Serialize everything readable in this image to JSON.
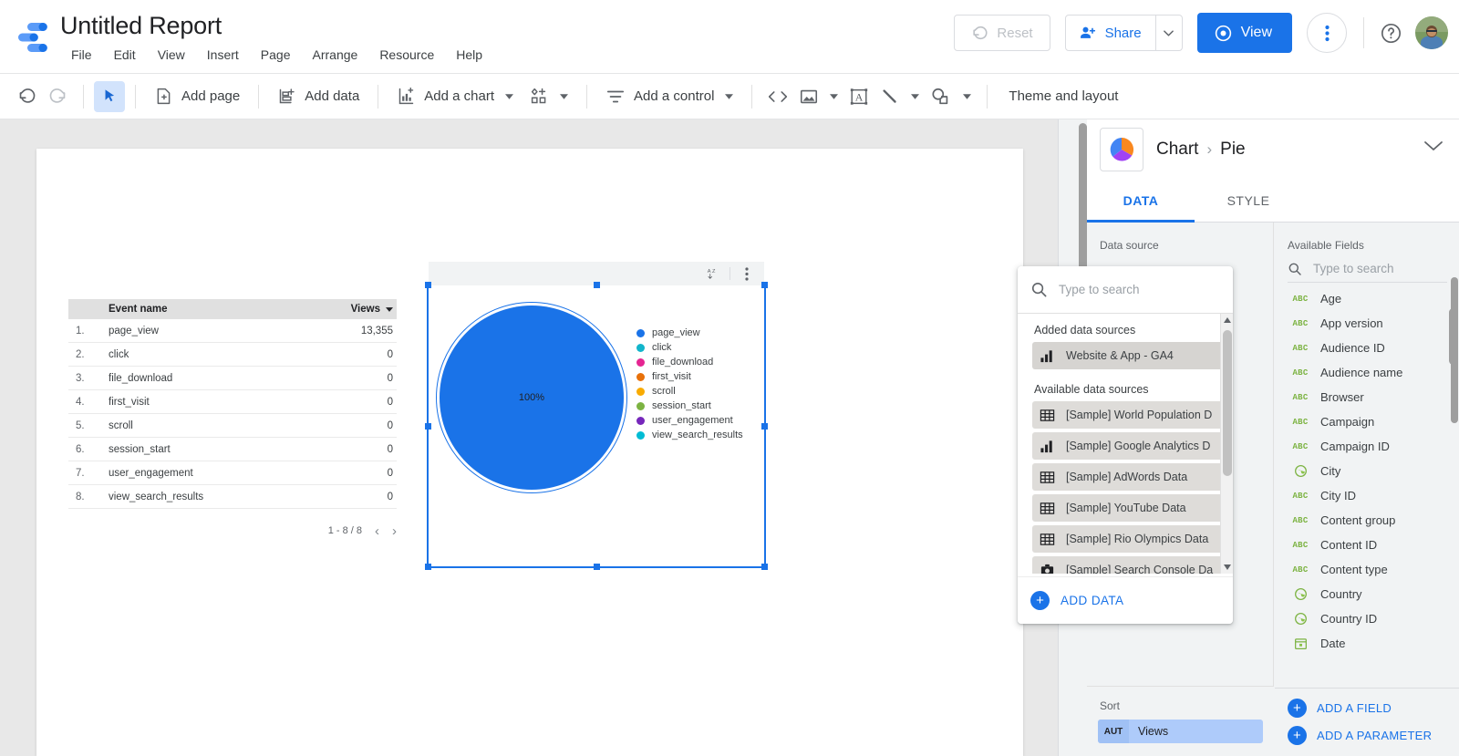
{
  "header": {
    "logo_name": "looker-studio-logo",
    "title": "Untitled Report",
    "menu": [
      "File",
      "Edit",
      "View",
      "Insert",
      "Page",
      "Arrange",
      "Resource",
      "Help"
    ],
    "reset_label": "Reset",
    "share_label": "Share",
    "view_label": "View",
    "more_label": "More options",
    "help_label": "Help",
    "avatar_label": "Account"
  },
  "toolbar": {
    "undo": "Undo",
    "redo": "Redo",
    "select": "Select tool",
    "add_page": "Add page",
    "add_data": "Add data",
    "add_chart": "Add a chart",
    "add_component": "Add a component",
    "add_control": "Add a control",
    "embed": "Embed code",
    "image": "Image",
    "text": "Text box",
    "line": "Line",
    "shape": "Shape",
    "theme": "Theme and layout"
  },
  "canvas": {
    "table": {
      "columns": [
        "",
        "Event name",
        "Views"
      ],
      "rows": [
        {
          "idx": "1.",
          "name": "page_view",
          "views": "13,355"
        },
        {
          "idx": "2.",
          "name": "click",
          "views": "0"
        },
        {
          "idx": "3.",
          "name": "file_download",
          "views": "0"
        },
        {
          "idx": "4.",
          "name": "first_visit",
          "views": "0"
        },
        {
          "idx": "5.",
          "name": "scroll",
          "views": "0"
        },
        {
          "idx": "6.",
          "name": "session_start",
          "views": "0"
        },
        {
          "idx": "7.",
          "name": "user_engagement",
          "views": "0"
        },
        {
          "idx": "8.",
          "name": "view_search_results",
          "views": "0"
        }
      ],
      "pagination": "1 - 8 / 8",
      "prev": "‹",
      "next": "›"
    },
    "chart_widget": {
      "sort_icon": "sort-az-icon",
      "more_icon": "more-vert-icon",
      "center_label": "100%"
    }
  },
  "chart_data": {
    "type": "pie",
    "title": "",
    "categories": [
      "page_view",
      "click",
      "file_download",
      "first_visit",
      "scroll",
      "session_start",
      "user_engagement",
      "view_search_results"
    ],
    "values": [
      13355,
      0,
      0,
      0,
      0,
      0,
      0,
      0
    ],
    "percentages": [
      100,
      0,
      0,
      0,
      0,
      0,
      0,
      0
    ],
    "colors": [
      "#1a73e8",
      "#12b5cb",
      "#e52592",
      "#e8710a",
      "#f9ab00",
      "#7cb342",
      "#7627bb",
      "#00bcd4"
    ],
    "data_labels": [
      "100%"
    ],
    "legend_position": "right",
    "metric": "Views",
    "dimension": "Event name"
  },
  "right_panel": {
    "breadcrumb_root": "Chart",
    "breadcrumb_sep": "›",
    "breadcrumb_leaf": "Pie",
    "collapse_icon": "chevron-down-icon",
    "thumb_icon": "pie-chart-icon",
    "tabs": [
      {
        "label": "DATA",
        "active": true
      },
      {
        "label": "STYLE",
        "active": false
      }
    ],
    "data_source_label": "Data source",
    "sort_label": "Sort",
    "sort_chip": {
      "badge": "AUT",
      "name": "Views"
    },
    "available_fields": {
      "title": "Available Fields",
      "search_placeholder": "Type to search",
      "search_value": "",
      "fields": [
        {
          "type": "ABC",
          "name": "Age"
        },
        {
          "type": "ABC",
          "name": "App version"
        },
        {
          "type": "ABC",
          "name": "Audience ID"
        },
        {
          "type": "ABC",
          "name": "Audience name"
        },
        {
          "type": "ABC",
          "name": "Browser"
        },
        {
          "type": "ABC",
          "name": "Campaign"
        },
        {
          "type": "ABC",
          "name": "Campaign ID"
        },
        {
          "type": "GEO",
          "name": "City"
        },
        {
          "type": "ABC",
          "name": "City ID"
        },
        {
          "type": "ABC",
          "name": "Content group"
        },
        {
          "type": "ABC",
          "name": "Content ID"
        },
        {
          "type": "ABC",
          "name": "Content type"
        },
        {
          "type": "GEO",
          "name": "Country"
        },
        {
          "type": "GEO",
          "name": "Country ID"
        },
        {
          "type": "DATE",
          "name": "Date"
        }
      ],
      "add_field": "ADD A FIELD",
      "add_parameter": "ADD A PARAMETER"
    }
  },
  "data_source_popup": {
    "search_placeholder": "Type to search",
    "search_value": "",
    "added_label": "Added data sources",
    "added": [
      {
        "icon": "bar-chart-icon",
        "name": "Website & App - GA4"
      }
    ],
    "available_label": "Available data sources",
    "available": [
      {
        "icon": "table-icon",
        "name": "[Sample] World Population D"
      },
      {
        "icon": "bar-chart-icon",
        "name": "[Sample] Google Analytics D"
      },
      {
        "icon": "table-icon",
        "name": "[Sample] AdWords Data"
      },
      {
        "icon": "table-icon",
        "name": "[Sample] YouTube Data"
      },
      {
        "icon": "table-icon",
        "name": "[Sample] Rio Olympics Data"
      },
      {
        "icon": "search-console-icon",
        "name": "[Sample] Search Console Da"
      }
    ],
    "add_data_label": "ADD DATA"
  },
  "colors": {
    "accent": "#1a73e8",
    "chip": "#aecbfa",
    "panel_bg": "#f1f3f4",
    "canvas_bg": "#e8e8e8",
    "field_green": "#7cb342"
  }
}
